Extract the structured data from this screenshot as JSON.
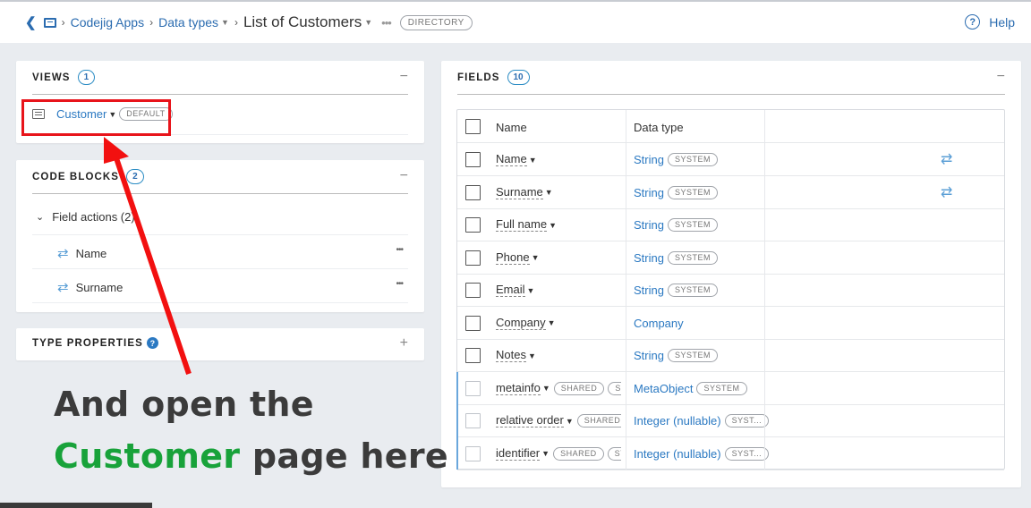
{
  "breadcrumb": {
    "app": "Codejig Apps",
    "data_types": "Data types",
    "title": "List of Customers",
    "badge": "DIRECTORY",
    "more": "•••"
  },
  "help": {
    "label": "Help",
    "icon": "?"
  },
  "views": {
    "title": "VIEWS",
    "count": "1",
    "toggle": "−",
    "item": {
      "label": "Customer",
      "badge": "DEFAULT"
    }
  },
  "code_blocks": {
    "title": "CODE BLOCKS",
    "count": "2",
    "toggle": "−",
    "group": "Field actions (2)",
    "items": [
      {
        "label": "Name",
        "menu": "•••"
      },
      {
        "label": "Surname",
        "menu": "•••"
      }
    ]
  },
  "type_properties": {
    "title": "TYPE PROPERTIES",
    "toggle": "+",
    "info": "?"
  },
  "fields": {
    "title": "FIELDS",
    "count": "10",
    "toggle": "−",
    "columns": [
      "Name",
      "Data type"
    ],
    "rows": [
      {
        "name": "Name",
        "shared": "",
        "type": "String",
        "type_badge": "SYSTEM",
        "sync": true
      },
      {
        "name": "Surname",
        "shared": "",
        "type": "String",
        "type_badge": "SYSTEM",
        "sync": true
      },
      {
        "name": "Full name",
        "shared": "",
        "type": "String",
        "type_badge": "SYSTEM",
        "sync": false
      },
      {
        "name": "Phone",
        "shared": "",
        "type": "String",
        "type_badge": "SYSTEM",
        "sync": false
      },
      {
        "name": "Email",
        "shared": "",
        "type": "String",
        "type_badge": "SYSTEM",
        "sync": false
      },
      {
        "name": "Company",
        "shared": "",
        "type": "Company",
        "type_badge": "",
        "sync": false
      },
      {
        "name": "Notes",
        "shared": "",
        "type": "String",
        "type_badge": "SYSTEM",
        "sync": false
      },
      {
        "name": "metainfo",
        "shared": "SHARED",
        "extra": "SY",
        "type": "MetaObject",
        "type_badge": "SYSTEM",
        "sync": false
      },
      {
        "name": "relative order",
        "shared": "SHARED",
        "extra": "",
        "type": "Integer (nullable)",
        "type_badge": "SYST...",
        "sync": false
      },
      {
        "name": "identifier",
        "shared": "SHARED",
        "extra": "SY",
        "type": "Integer (nullable)",
        "type_badge": "SYST...",
        "sync": false
      }
    ]
  },
  "annotation": {
    "line1": "And open the",
    "line2_highlight": "Customer",
    "line2_rest": " page here"
  },
  "colors": {
    "accent": "#2b79c2",
    "highlight_box": "#e8141b",
    "arrow": "#f21010",
    "annotation_green": "#18a23a"
  }
}
